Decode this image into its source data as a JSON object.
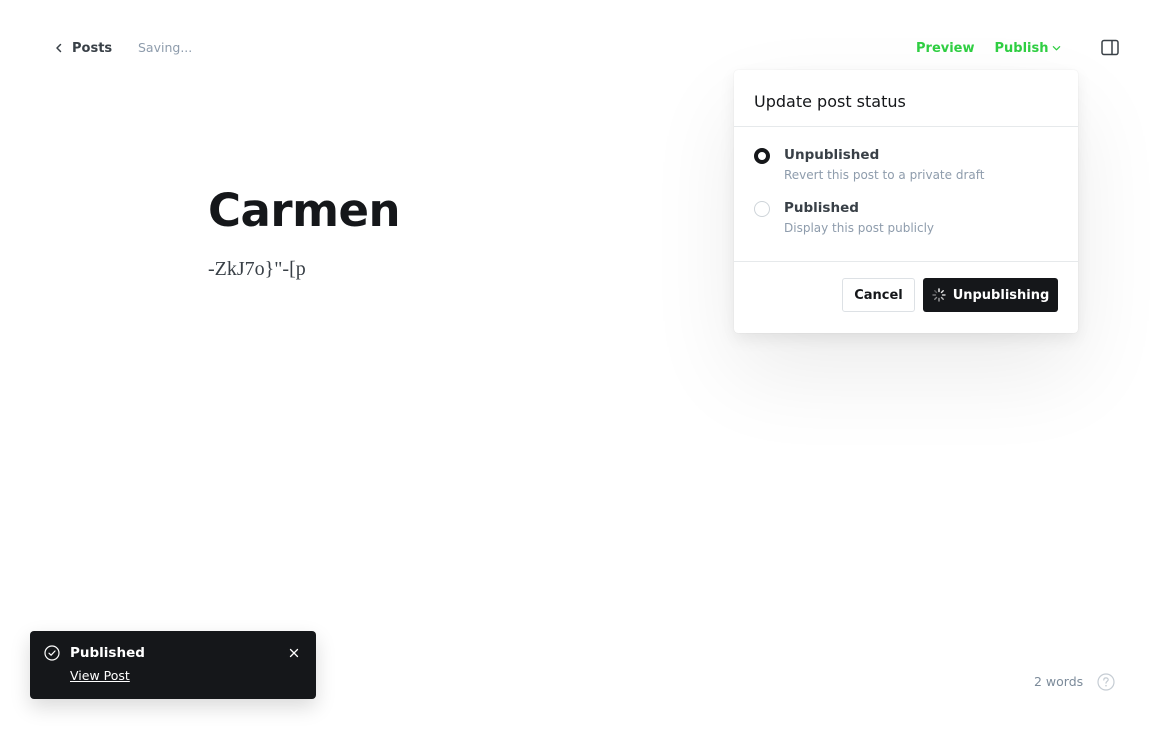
{
  "header": {
    "back_label": "Posts",
    "save_status": "Saving...",
    "preview_label": "Preview",
    "publish_label": "Publish"
  },
  "editor": {
    "title": "Carmen",
    "body": "-ZkJ7o}\"-[p"
  },
  "status_dropdown": {
    "title": "Update post status",
    "options": [
      {
        "label": "Unpublished",
        "description": "Revert this post to a private draft",
        "selected": true
      },
      {
        "label": "Published",
        "description": "Display this post publicly",
        "selected": false
      }
    ],
    "cancel_label": "Cancel",
    "confirm_label": "Unpublishing"
  },
  "toast": {
    "title": "Published",
    "link_label": "View Post"
  },
  "footer": {
    "word_count": "2 words"
  },
  "colors": {
    "accent_green": "#30cf43",
    "dark": "#15171a"
  },
  "icons": [
    "chevron-left-icon",
    "chevron-down-icon",
    "sidebar-toggle-icon",
    "spinner-icon",
    "check-circle-icon",
    "close-icon",
    "help-icon"
  ]
}
